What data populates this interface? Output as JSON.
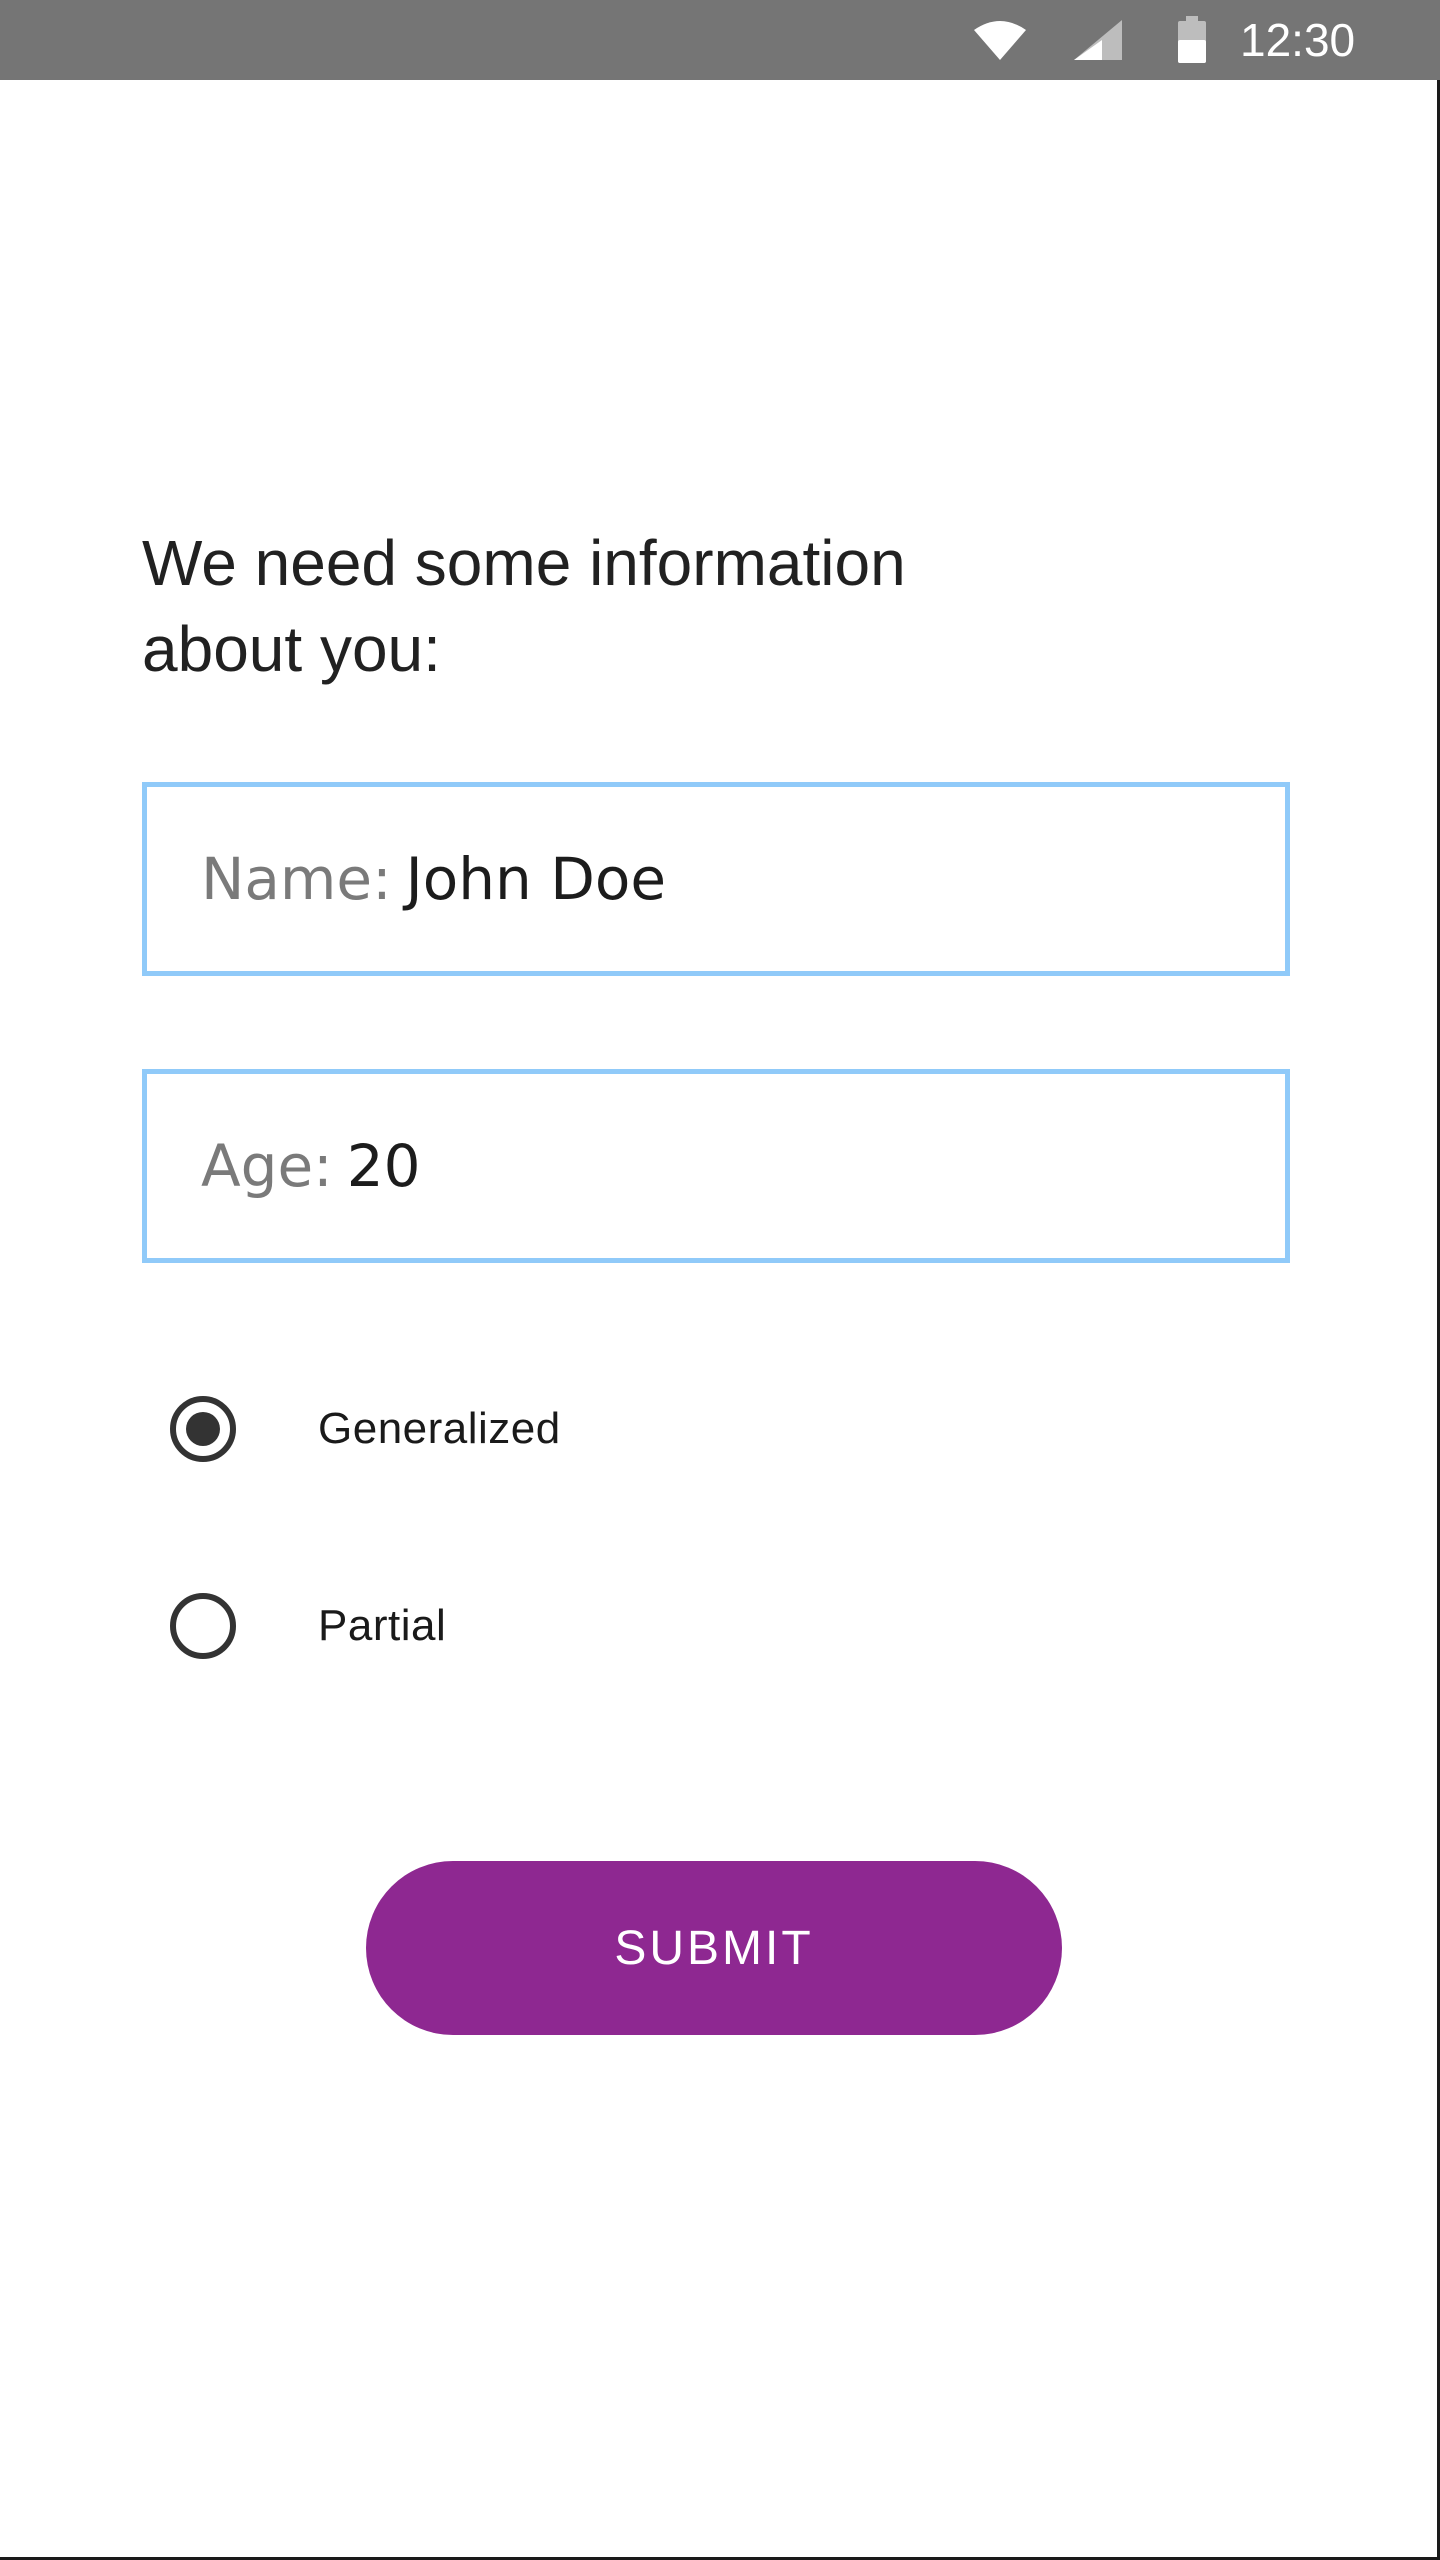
{
  "status_bar": {
    "time": "12:30",
    "icons": [
      "wifi-icon",
      "cellular-signal-icon",
      "battery-icon"
    ]
  },
  "form": {
    "headline": "We need some information\nabout you:",
    "name_field": {
      "label": "Name:",
      "value": "John Doe"
    },
    "age_field": {
      "label": "Age:",
      "value": "20"
    },
    "radio_options": [
      {
        "label": "Generalized",
        "selected": true
      },
      {
        "label": "Partial",
        "selected": false
      }
    ],
    "submit_label": "SUBMIT"
  },
  "colors": {
    "status_bar": "#757575",
    "field_border": "#90caf9",
    "accent": "#8e2891",
    "radio": "#333333"
  }
}
